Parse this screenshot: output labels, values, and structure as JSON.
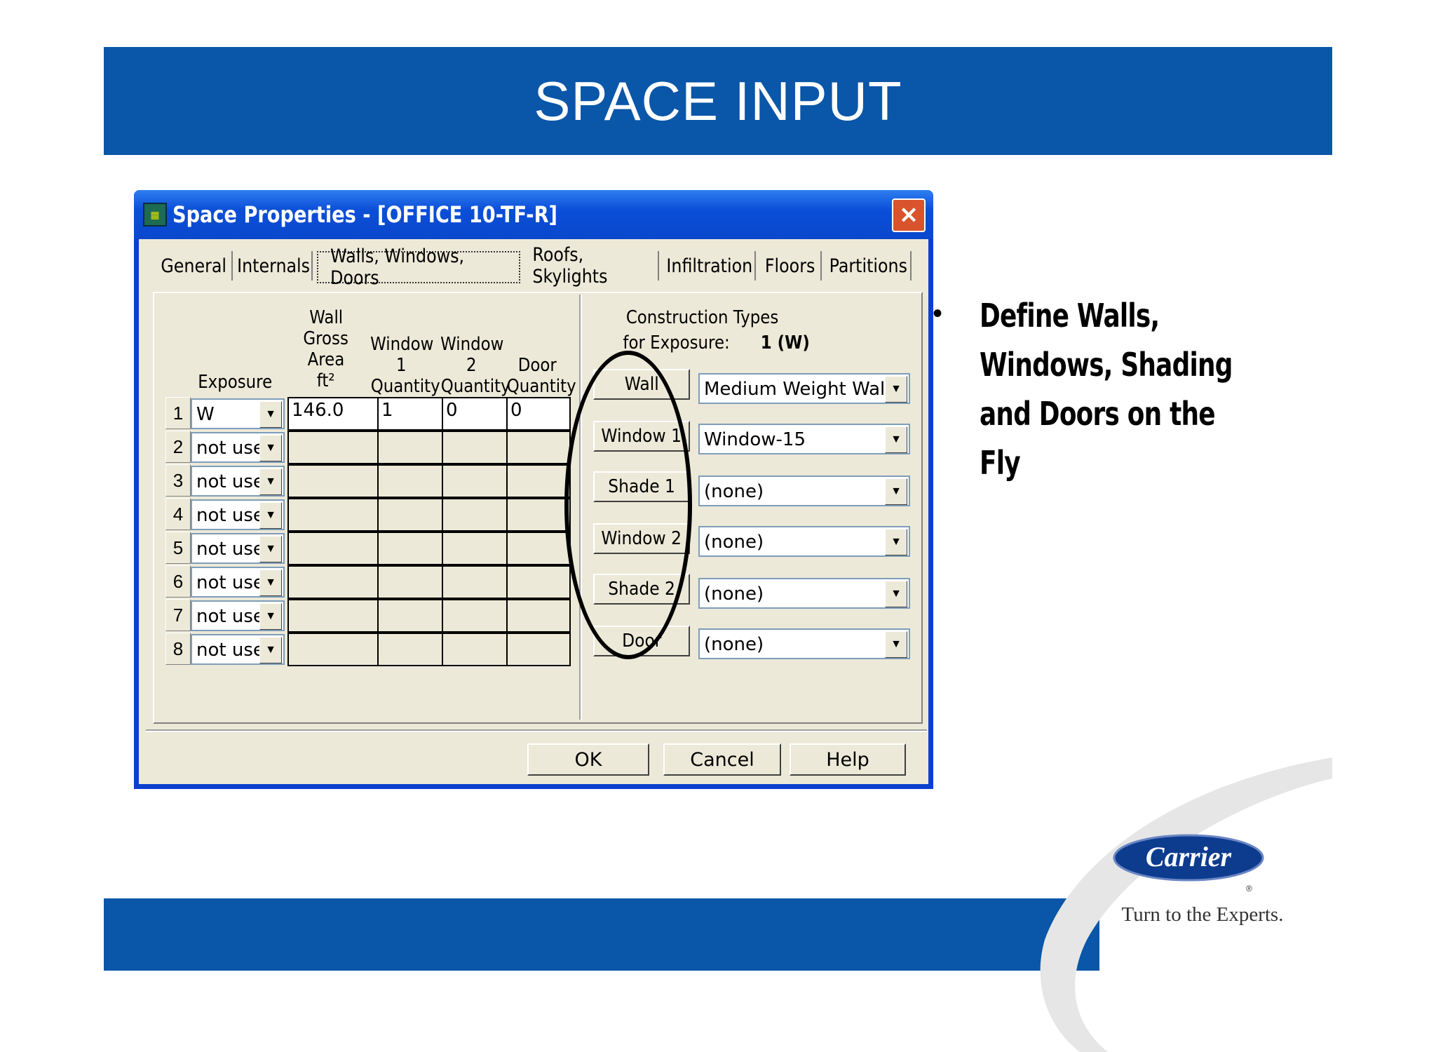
{
  "slide": {
    "title": "SPACE INPUT",
    "bullet": "Define Walls, Windows, Shading and Doors on the Fly",
    "bullet_dot": "•"
  },
  "branding": {
    "logo_text": "Carrier",
    "registered": "®",
    "tagline": "Turn to the Experts.",
    "brand_color": "#0a56a8"
  },
  "dialog": {
    "title": "Space Properties - [OFFICE 10-TF-R]",
    "close_glyph": "✕",
    "tabs": [
      "General",
      "Internals",
      "Walls, Windows, Doors",
      "Roofs, Skylights",
      "Infiltration",
      "Floors",
      "Partitions"
    ],
    "active_tab": "Walls, Windows, Doors",
    "headers": {
      "exposure": "Exposure",
      "wall_area": [
        "Wall",
        "Gross",
        "Area",
        "ft²"
      ],
      "window1": [
        "Window",
        "1",
        "Quantity"
      ],
      "window2": [
        "Window",
        "2",
        "Quantity"
      ],
      "door": [
        "Door",
        "Quantity"
      ]
    },
    "rows": [
      {
        "num": "1",
        "exposure": "W",
        "wall_area": "146.0",
        "window1": "1",
        "window2": "0",
        "door": "0"
      },
      {
        "num": "2",
        "exposure": "not used",
        "wall_area": "",
        "window1": "",
        "window2": "",
        "door": ""
      },
      {
        "num": "3",
        "exposure": "not used",
        "wall_area": "",
        "window1": "",
        "window2": "",
        "door": ""
      },
      {
        "num": "4",
        "exposure": "not used",
        "wall_area": "",
        "window1": "",
        "window2": "",
        "door": ""
      },
      {
        "num": "5",
        "exposure": "not used",
        "wall_area": "",
        "window1": "",
        "window2": "",
        "door": ""
      },
      {
        "num": "6",
        "exposure": "not used",
        "wall_area": "",
        "window1": "",
        "window2": "",
        "door": ""
      },
      {
        "num": "7",
        "exposure": "not used",
        "wall_area": "",
        "window1": "",
        "window2": "",
        "door": ""
      },
      {
        "num": "8",
        "exposure": "not used",
        "wall_area": "",
        "window1": "",
        "window2": "",
        "door": ""
      }
    ],
    "construction": {
      "heading_line1": "Construction Types",
      "heading_line2": "for Exposure:",
      "exposure_value": "1 (W)",
      "items": [
        {
          "label": "Wall",
          "value": "Medium Weight Wall"
        },
        {
          "label": "Window 1",
          "value": "Window-15"
        },
        {
          "label": "Shade 1",
          "value": "(none)"
        },
        {
          "label": "Window 2",
          "value": "(none)"
        },
        {
          "label": "Shade 2",
          "value": "(none)"
        },
        {
          "label": "Door",
          "value": "(none)"
        }
      ]
    },
    "buttons": {
      "ok": "OK",
      "cancel": "Cancel",
      "help": "Help"
    },
    "dropdown_glyph": "▼"
  }
}
